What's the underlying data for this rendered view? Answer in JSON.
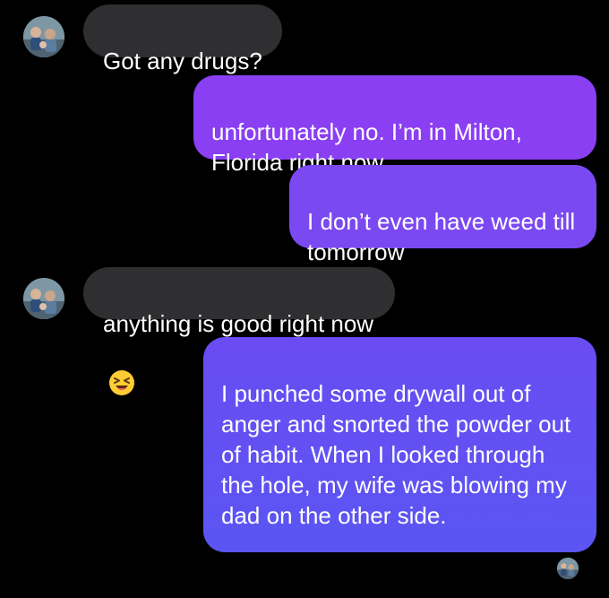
{
  "colors": {
    "background": "#000000",
    "received_bubble": "#2f2f31",
    "sent_gradient_top": "#8a3ff2",
    "sent_gradient_bottom": "#5a55f3",
    "text": "#ffffff"
  },
  "conversation": {
    "messages": [
      {
        "direction": "received",
        "text": "Got any drugs?"
      },
      {
        "direction": "sent",
        "text": "unfortunately no.  I’m in Milton, Florida right now"
      },
      {
        "direction": "sent",
        "text": "I don’t even have weed till tomorrow"
      },
      {
        "direction": "received",
        "text": "anything is good right now",
        "emoji": "laughing-squinting-face-icon"
      },
      {
        "direction": "sent",
        "text": "I punched some drywall out of anger and snorted the powder out of habit.  When I looked through the hole, my wife was blowing my dad on the other side."
      }
    ]
  }
}
